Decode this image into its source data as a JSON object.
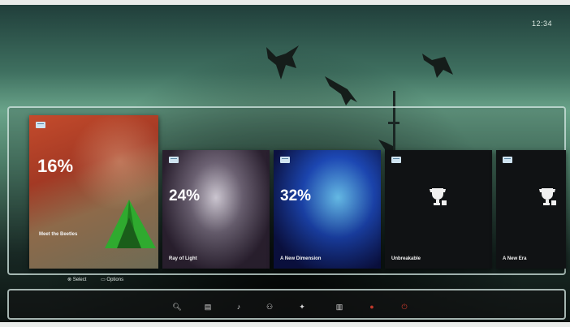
{
  "clock": "12:34",
  "shelf": {
    "tiles": [
      {
        "percent": "16%",
        "title": "Meet the Beetles",
        "icon": "game-badge-icon"
      },
      {
        "percent": "24%",
        "title": "Ray of Light",
        "icon": "game-badge-icon"
      },
      {
        "percent": "32%",
        "title": "A New Dimension",
        "icon": "game-badge-icon"
      },
      {
        "title": "Unbreakable",
        "icon": "trophy-icon"
      },
      {
        "title": "A New Era",
        "icon": "trophy-icon"
      }
    ]
  },
  "prompts": [
    "Select",
    "Options"
  ],
  "taskbar": {
    "icons": [
      "search-icon",
      "store-icon",
      "music-icon",
      "friends-icon",
      "game-icon",
      "library-icon",
      "notification-icon",
      "power-icon"
    ]
  },
  "colors": {
    "accent_red": "#c0392b",
    "frame": "#e9ecea"
  }
}
